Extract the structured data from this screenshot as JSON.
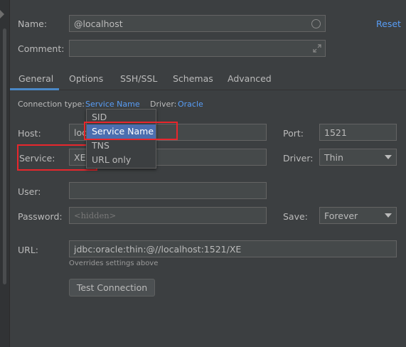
{
  "header": {
    "name_label": "Name:",
    "name_value": "@localhost",
    "reset_label": "Reset",
    "comment_label": "Comment:",
    "comment_value": ""
  },
  "tabs": [
    {
      "label": "General",
      "active": true
    },
    {
      "label": "Options",
      "active": false
    },
    {
      "label": "SSH/SSL",
      "active": false
    },
    {
      "label": "Schemas",
      "active": false
    },
    {
      "label": "Advanced",
      "active": false
    }
  ],
  "connection": {
    "type_label": "Connection type:",
    "type_value": "Service Name",
    "driver_label": "Driver:",
    "driver_value": "Oracle"
  },
  "popup": {
    "items": [
      "SID",
      "Service Name",
      "TNS",
      "URL only"
    ],
    "selected": "Service Name"
  },
  "form": {
    "host_label": "Host:",
    "host_value": "localhost",
    "port_label": "Port:",
    "port_value": "1521",
    "service_label": "Service:",
    "service_value": "XE",
    "driver_label": "Driver:",
    "driver_value": "Thin",
    "user_label": "User:",
    "user_value": "",
    "password_label": "Password:",
    "password_placeholder": "<hidden>",
    "save_label": "Save:",
    "save_value": "Forever",
    "url_label": "URL:",
    "url_value": "jdbc:oracle:thin:@//localhost:1521/XE",
    "url_hint": "Overrides settings above",
    "test_button": "Test Connection"
  },
  "colors": {
    "background": "#3c3f41",
    "link": "#589df6",
    "selection": "#4b6eaf",
    "highlight_box": "#e8262c"
  }
}
